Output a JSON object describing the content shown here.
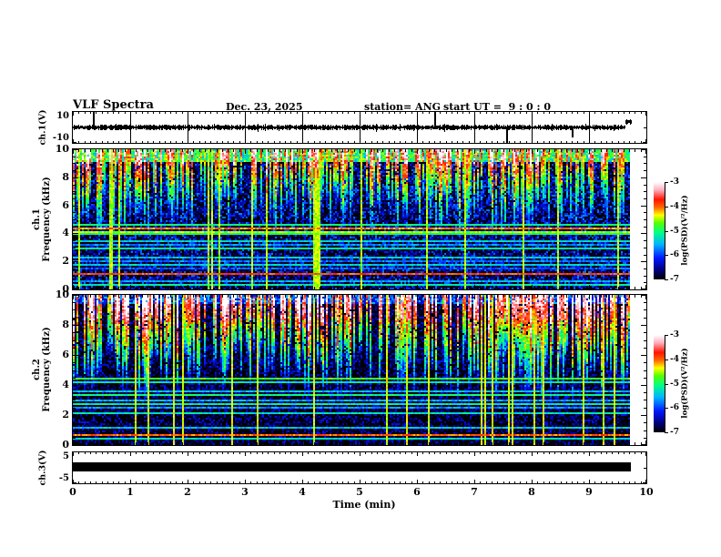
{
  "header": {
    "title": "VLF Spectra",
    "date": "Dec. 23, 2025",
    "station": "station= ANG",
    "start_ut": "start UT =  9 : 0 : 0"
  },
  "x_axis": {
    "label": "Time (min)",
    "tick_labels": [
      "0",
      "1",
      "2",
      "3",
      "4",
      "5",
      "6",
      "7",
      "8",
      "9",
      "10"
    ],
    "min": 0,
    "max": 10,
    "minor_step": 0.1,
    "data_end_min": 9.73
  },
  "panels": {
    "ch1_wave": {
      "ylabel": "ch.1(V)",
      "ytick_labels": [
        "10",
        "-10"
      ],
      "ytick_values": [
        10,
        -10
      ],
      "ylim": [
        -14,
        14
      ]
    },
    "ch1_spec": {
      "ylabel_ch": "ch.1",
      "ylabel_freq": "Frequency (kHz)",
      "ytick_labels": [
        "0",
        "2",
        "4",
        "6",
        "8",
        "10"
      ],
      "ytick_values": [
        0,
        2,
        4,
        6,
        8,
        10
      ],
      "ylim": [
        0,
        10
      ],
      "y_minor_step": 0.5
    },
    "ch2_spec": {
      "ylabel_ch": "ch.2",
      "ylabel_freq": "Frequency (kHz)",
      "ytick_labels": [
        "0",
        "2",
        "4",
        "6",
        "8",
        "10"
      ],
      "ytick_values": [
        0,
        2,
        4,
        6,
        8,
        10
      ],
      "ylim": [
        0,
        10
      ],
      "y_minor_step": 0.5
    },
    "ch3_wave": {
      "ylabel": "ch.3(V)",
      "ytick_labels": [
        "5",
        "-5"
      ],
      "ytick_values": [
        5,
        -5
      ],
      "ylim": [
        -7,
        7
      ]
    }
  },
  "colorbar": {
    "label": "log(PSD)(V²/Hz)",
    "tick_labels": [
      "-3",
      "-4",
      "-5",
      "-6",
      "-7"
    ],
    "tick_values": [
      -3,
      -4,
      -5,
      -6,
      -7
    ],
    "vmin": -7,
    "vmax": -3,
    "gradient_stops": [
      {
        "t": 0.0,
        "c": "#000000"
      },
      {
        "t": 0.1,
        "c": "#000080"
      },
      {
        "t": 0.22,
        "c": "#0018ff"
      },
      {
        "t": 0.36,
        "c": "#00b4ff"
      },
      {
        "t": 0.48,
        "c": "#00ff88"
      },
      {
        "t": 0.58,
        "c": "#55ff00"
      },
      {
        "t": 0.66,
        "c": "#ffff00"
      },
      {
        "t": 0.74,
        "c": "#ff6600"
      },
      {
        "t": 0.82,
        "c": "#ff1500"
      },
      {
        "t": 0.92,
        "c": "#ffb0c0"
      },
      {
        "t": 1.0,
        "c": "#ffffff"
      }
    ]
  },
  "chart_data": [
    {
      "type": "line",
      "series_name": "ch.1 raw voltage",
      "xlabel": "Time (min)",
      "ylabel": "ch.1(V)",
      "xlim": [
        0,
        10
      ],
      "ylim": [
        -14,
        14
      ],
      "yticks": [
        10,
        -10
      ],
      "baseline_v": 0,
      "noise_amplitude_v": 1.1,
      "spikes": [
        {
          "t_min": 0.35,
          "v": 8
        },
        {
          "t_min": 6.3,
          "v": 7
        },
        {
          "t_min": 7.55,
          "v": -9
        },
        {
          "t_min": 8.7,
          "v": -4.5
        }
      ],
      "end_step": {
        "t_start": 9.62,
        "t_end": 9.73,
        "v": 2.5
      },
      "data_end_min": 9.73,
      "seed": 7
    },
    {
      "type": "heatmap",
      "series_name": "ch.1 spectrogram",
      "ylabel": "ch.1 Frequency (kHz)",
      "xlim": [
        0,
        10
      ],
      "ylim": [
        0,
        10
      ],
      "yticks": [
        0,
        2,
        4,
        6,
        8,
        10
      ],
      "value_range": [
        -7,
        -3
      ],
      "units": "log(PSD)(V²/Hz)",
      "seed": 1337,
      "background_level": -6.7,
      "noise": 1.2,
      "top_band": {
        "fmin": 9.1,
        "level": -5.0
      },
      "red_fmin": 9.2,
      "vertical_streaks": {
        "density": 0.55,
        "fmin_range": [
          3.2,
          6.8
        ],
        "strength_range": [
          0.8,
          2.6
        ],
        "top_red_fraction": 0.13
      },
      "full_height_lines": {
        "density": 0.05,
        "level": -4.5
      },
      "horizontal_lines": [
        {
          "f": 4.35,
          "level": -4.1,
          "w": 0.16
        },
        {
          "f": 4.12,
          "level": -4.5,
          "w": 0.12
        },
        {
          "f": 3.95,
          "level": -5.0,
          "w": 0.1
        },
        {
          "f": 4.6,
          "level": -5.1,
          "w": 0.1
        },
        {
          "f": 3.45,
          "level": -5.4,
          "w": 0.1
        },
        {
          "f": 3.15,
          "level": -5.7,
          "w": 0.1
        },
        {
          "f": 2.9,
          "level": -5.2,
          "w": 0.1
        },
        {
          "f": 2.6,
          "level": -5.8,
          "w": 0.1
        },
        {
          "f": 2.3,
          "level": -5.5,
          "w": 0.1
        },
        {
          "f": 2.05,
          "level": -5.8,
          "w": 0.1
        },
        {
          "f": 1.75,
          "level": -5.4,
          "w": 0.1
        },
        {
          "f": 1.5,
          "level": -5.9,
          "w": 0.1
        },
        {
          "f": 1.15,
          "level": -3.9,
          "w": 0.1
        },
        {
          "f": 0.9,
          "level": -5.3,
          "w": 0.1
        },
        {
          "f": 0.55,
          "level": -5.6,
          "w": 0.1
        },
        {
          "f": 0.3,
          "level": -5.2,
          "w": 0.1
        }
      ],
      "data_end_min": 9.73
    },
    {
      "type": "heatmap",
      "series_name": "ch.2 spectrogram",
      "ylabel": "ch.2 Frequency (kHz)",
      "xlim": [
        0,
        10
      ],
      "ylim": [
        0,
        10
      ],
      "yticks": [
        0,
        2,
        4,
        6,
        8,
        10
      ],
      "value_range": [
        -7,
        -3
      ],
      "units": "log(PSD)(V²/Hz)",
      "seed": 4242,
      "background_level": -6.95,
      "noise": 1.0,
      "top_band": {
        "fmin": 9.4,
        "level": -6.0
      },
      "red_fmin": 8.3,
      "vertical_streaks": {
        "density": 0.6,
        "fmin_range": [
          2.5,
          6.5
        ],
        "strength_range": [
          0.9,
          3.0
        ],
        "top_red_fraction": 0.3
      },
      "full_height_lines": {
        "density": 0.08,
        "level": -4.4
      },
      "horizontal_lines": [
        {
          "f": 4.45,
          "level": -4.8,
          "w": 0.12
        },
        {
          "f": 4.2,
          "level": -5.2,
          "w": 0.1
        },
        {
          "f": 3.6,
          "level": -5.5,
          "w": 0.1
        },
        {
          "f": 3.3,
          "level": -5.1,
          "w": 0.1
        },
        {
          "f": 3.0,
          "level": -5.6,
          "w": 0.1
        },
        {
          "f": 2.7,
          "level": -5.2,
          "w": 0.1
        },
        {
          "f": 2.45,
          "level": -5.7,
          "w": 0.1
        },
        {
          "f": 2.1,
          "level": -5.3,
          "w": 0.1
        },
        {
          "f": 1.8,
          "level": -5.6,
          "w": 0.1
        },
        {
          "f": 1.45,
          "level": -5.2,
          "w": 0.1
        },
        {
          "f": 1.1,
          "level": -5.5,
          "w": 0.1
        },
        {
          "f": 0.7,
          "level": -4.0,
          "w": 0.12
        },
        {
          "f": 0.4,
          "level": -5.3,
          "w": 0.1
        }
      ],
      "data_end_min": 9.73
    },
    {
      "type": "line",
      "series_name": "ch.3 voltage",
      "ylabel": "ch.3(V)",
      "xlim": [
        0,
        10
      ],
      "ylim": [
        -7,
        7
      ],
      "yticks": [
        5,
        -5
      ],
      "constant_v": 0.2,
      "line_halfwidth_v": 1.0,
      "data_end_min": 9.73
    }
  ]
}
